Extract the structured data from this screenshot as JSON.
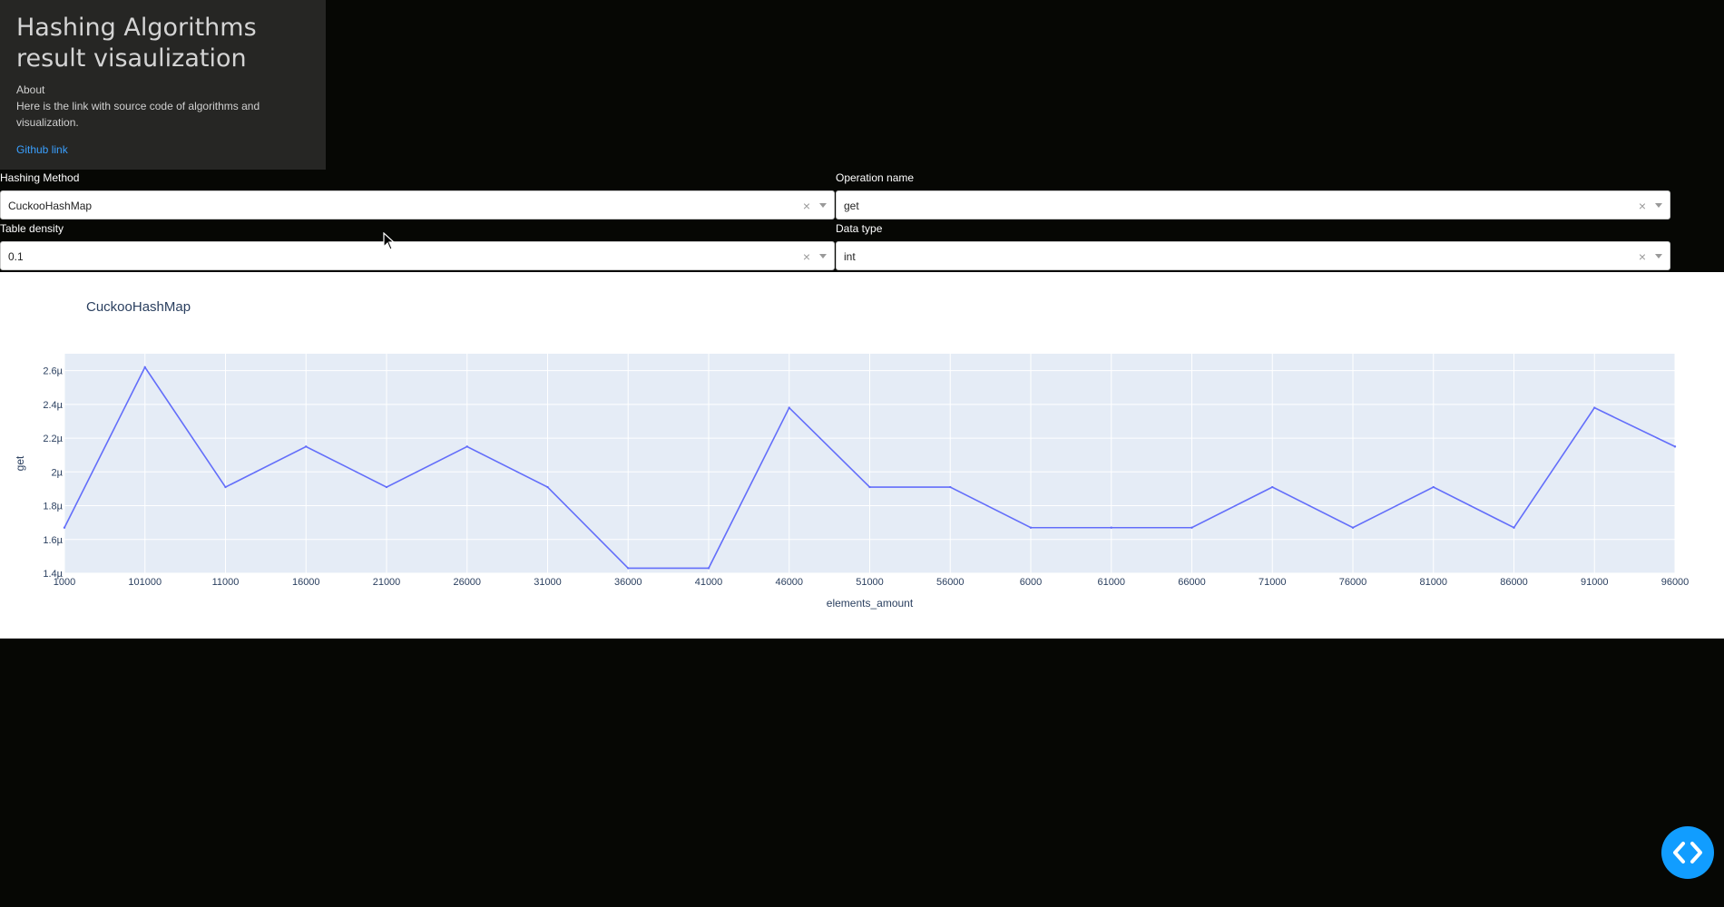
{
  "about": {
    "title": "Hashing Algorithms result visaulization",
    "heading": "About",
    "text": "Here is the link with source code of algorithms and visualization.",
    "link_text": "Github link"
  },
  "filters": {
    "hashing_method": {
      "label": "Hashing Method",
      "value": "CuckooHashMap"
    },
    "operation_name": {
      "label": "Operation name",
      "value": "get"
    },
    "table_density": {
      "label": "Table density",
      "value": "0.1"
    },
    "data_type": {
      "label": "Data type",
      "value": "int"
    },
    "clear_glyph": "×"
  },
  "chart_data": {
    "type": "line",
    "title": "CuckooHashMap",
    "xlabel": "elements_amount",
    "ylabel": "get",
    "categories": [
      "1000",
      "101000",
      "11000",
      "16000",
      "21000",
      "26000",
      "31000",
      "36000",
      "41000",
      "46000",
      "51000",
      "56000",
      "6000",
      "61000",
      "66000",
      "71000",
      "76000",
      "81000",
      "86000",
      "91000",
      "96000"
    ],
    "values": [
      1.67,
      2.62,
      1.91,
      2.15,
      1.91,
      2.15,
      1.91,
      1.43,
      1.43,
      2.38,
      1.91,
      1.91,
      1.67,
      1.67,
      1.67,
      1.91,
      1.67,
      1.91,
      1.67,
      2.38,
      2.15
    ],
    "yticks": [
      "1.4µ",
      "1.6µ",
      "1.8µ",
      "2µ",
      "2.2µ",
      "2.4µ",
      "2.6µ"
    ],
    "ylim": [
      1.4,
      2.7
    ],
    "line_color": "#636efa",
    "plot_bg": "#e5ecf6",
    "grid": true
  },
  "nav_button": {
    "icon": "code-chevrons-icon",
    "color": "#119dff"
  }
}
